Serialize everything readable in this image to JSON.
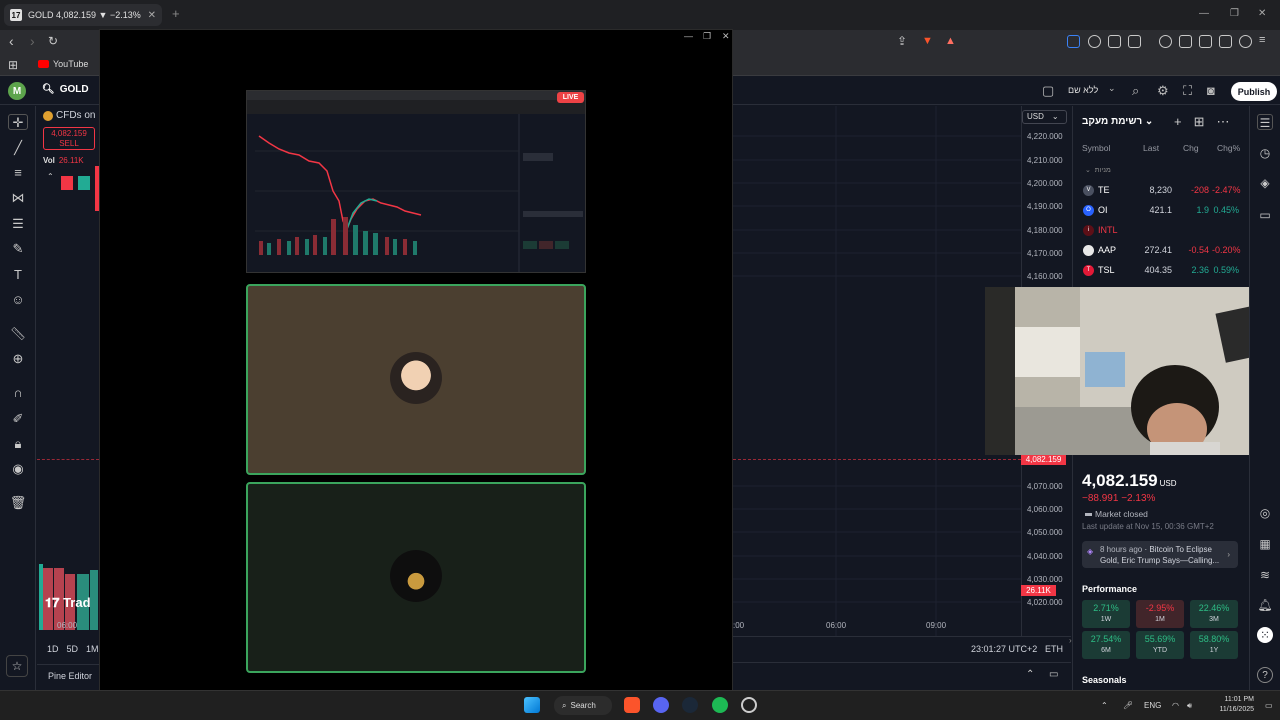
{
  "browser": {
    "tab_title": "GOLD 4,082.159 ▼ −2.13% ...",
    "tab_favicon": "17",
    "bookmark_youtube": "YouTube",
    "new_tab_symbol": "+"
  },
  "header": {
    "avatar_letter": "M",
    "symbol": "GOLD",
    "layout_name": "ללא שם",
    "publish_label": "Publish"
  },
  "chart_left": {
    "cfd_label": "CFDs on",
    "sell_price": "4,082.159",
    "sell_label": "SELL",
    "vol_label": "Vol",
    "vol_value": "26.11K",
    "logo_text": "Trad",
    "time_label": "06:00",
    "ranges": [
      "1D",
      "5D",
      "1M"
    ],
    "pine_editor": "Pine Editor"
  },
  "screenshare": {
    "live_label": "LIVE"
  },
  "price_scale": {
    "currency": "USD",
    "ticks": [
      "4,220.000",
      "4,210.000",
      "4,200.000",
      "4,190.000",
      "4,180.000",
      "4,170.000",
      "4,160.000",
      "4,070.000",
      "4,060.000",
      "4,050.000",
      "4,040.000",
      "4,030.000",
      "4,020.000"
    ],
    "current_price_tag": "4,082.159",
    "volume_tag": "26.11K"
  },
  "time_axis": {
    "ticks": [
      ":00",
      "06:00",
      "09:00"
    ],
    "clock": "23:01:27 UTC+2",
    "session": "ETH"
  },
  "watchlist": {
    "title": "רשימת מעקב",
    "headers": {
      "symbol": "Symbol",
      "last": "Last",
      "chg": "Chg",
      "chgp": "Chg%"
    },
    "group_label": "מניות",
    "rows": [
      {
        "icon": "V",
        "symbol": "TE",
        "last": "8,230",
        "chg": "-208",
        "chgp": "-2.47%",
        "icon_color": "#4a5060",
        "dir": "neg"
      },
      {
        "icon": "O",
        "symbol": "OI",
        "last": "421.1",
        "chg": "1.9",
        "chgp": "0.45%",
        "icon_color": "#2962ff",
        "dir": "pos"
      },
      {
        "icon": "i",
        "symbol": "INTL",
        "last": "",
        "chg": "",
        "chgp": "",
        "icon_color": "#5d0f17",
        "dir": "neg"
      },
      {
        "icon": "",
        "symbol": "AAP",
        "last": "272.41",
        "chg": "-0.54",
        "chgp": "-0.20%",
        "icon_color": "#e8e8e8",
        "dir": "neg"
      },
      {
        "icon": "T",
        "symbol": "TSL",
        "last": "404.35",
        "chg": "2.36",
        "chgp": "0.59%",
        "icon_color": "#e31937",
        "dir": "pos"
      }
    ]
  },
  "details": {
    "price": "4,082.159",
    "currency": "USD",
    "change": "−88.991  −2.13%",
    "market_status": "Market closed",
    "last_update": "Last update at Nov 15, 00:36 GMT+2",
    "news_time": "8 hours ago",
    "news_text_1": "Bitcoin To Eclipse",
    "news_text_2": "Gold, Eric Trump Says—Calling...",
    "performance_title": "Performance",
    "performance": [
      {
        "value": "2.71%",
        "label": "1W",
        "dir": "p"
      },
      {
        "value": "-2.95%",
        "label": "1M",
        "dir": "n"
      },
      {
        "value": "22.46%",
        "label": "3M",
        "dir": "p"
      },
      {
        "value": "27.54%",
        "label": "6M",
        "dir": "p"
      },
      {
        "value": "55.69%",
        "label": "YTD",
        "dir": "p"
      },
      {
        "value": "58.80%",
        "label": "1Y",
        "dir": "p"
      }
    ],
    "seasonals_title": "Seasonals"
  },
  "taskbar": {
    "search_label": "Search",
    "lang": "ENG",
    "time": "11:01 PM",
    "date": "11/16/2025"
  },
  "colors": {
    "bg": "#131722",
    "down": "#f23645",
    "up": "#22ab94",
    "discord_green": "#3ba55d"
  }
}
